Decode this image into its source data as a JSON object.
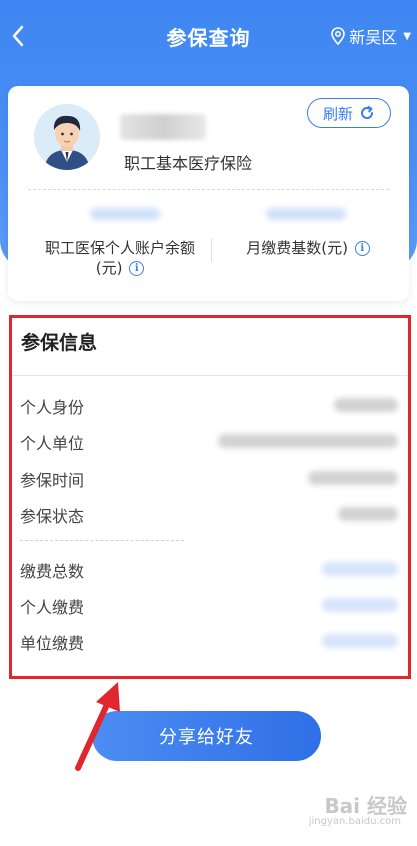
{
  "header": {
    "title": "参保查询",
    "region": "新吴区",
    "back_icon": "chevron-left-icon",
    "region_icon": "location-pin-icon"
  },
  "card": {
    "insurance_type": "职工基本医疗保险",
    "refresh_label": "刷新",
    "stat_left_label": "职工医保个人账户余额(元)",
    "stat_right_label": "月缴费基数(元)"
  },
  "info": {
    "title": "参保信息",
    "rows": [
      {
        "label": "个人身份"
      },
      {
        "label": "个人单位"
      },
      {
        "label": "参保时间"
      },
      {
        "label": "参保状态"
      },
      {
        "label": "缴费总数"
      },
      {
        "label": "个人缴费"
      },
      {
        "label": "单位缴费"
      }
    ]
  },
  "share_label": "分享给好友",
  "watermark": {
    "main": "Bai 经验",
    "sub": "jingyan.baidu.com"
  },
  "colors": {
    "primary": "#3a7df0",
    "highlight_border": "#e0262f"
  }
}
